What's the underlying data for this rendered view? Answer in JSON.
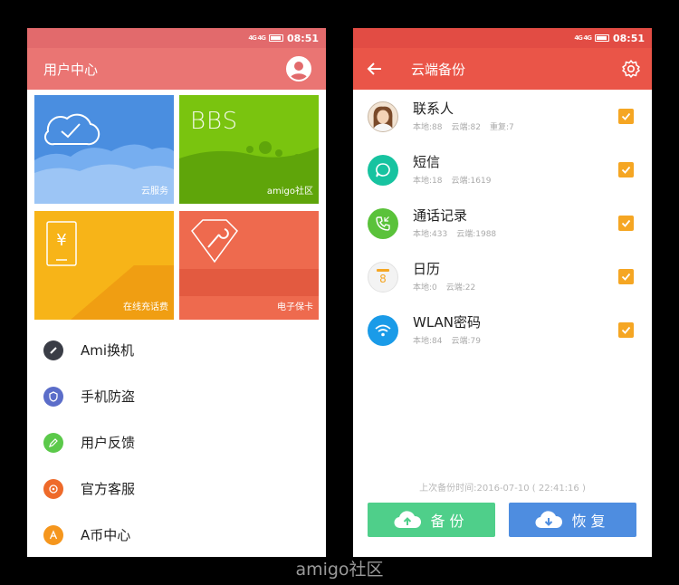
{
  "status_bar": {
    "signal": "4G 4G",
    "time": "08:51"
  },
  "left_screen": {
    "title": "用户中心",
    "tiles": [
      {
        "id": "cloud",
        "label": "云服务",
        "color": "#4a8ee0"
      },
      {
        "id": "bbs",
        "label": "amigo社区",
        "logo_text": "BBS",
        "color": "#7ac40f"
      },
      {
        "id": "recharge",
        "label": "在线充话费",
        "color": "#f7b418"
      },
      {
        "id": "card",
        "label": "电子保卡",
        "color": "#ee6a4e"
      }
    ],
    "menu": [
      {
        "label": "Ami换机",
        "icon": "ami-switch-icon",
        "color": "#3a3d46"
      },
      {
        "label": "手机防盗",
        "icon": "shield-icon",
        "color": "#5b6dc9"
      },
      {
        "label": "用户反馈",
        "icon": "feedback-icon",
        "color": "#5bc94a"
      },
      {
        "label": "官方客服",
        "icon": "customer-service-icon",
        "color": "#ee6a2a"
      },
      {
        "label": "A币中心",
        "icon": "a-coin-icon",
        "color": "#f5961d"
      }
    ]
  },
  "right_screen": {
    "title": "云端备份",
    "items": [
      {
        "name": "联系人",
        "local": "本地:88",
        "cloud": "云端:82",
        "extra": "重复:7",
        "icon": "contacts-avatar-icon",
        "checked": true
      },
      {
        "name": "短信",
        "local": "本地:18",
        "cloud": "云端:1619",
        "extra": "",
        "icon": "sms-icon",
        "checked": true
      },
      {
        "name": "通话记录",
        "local": "本地:433",
        "cloud": "云端:1988",
        "extra": "",
        "icon": "call-log-icon",
        "checked": true
      },
      {
        "name": "日历",
        "local": "本地:0",
        "cloud": "云端:22",
        "extra": "",
        "icon": "calendar-icon",
        "calendar_day": "8",
        "checked": true
      },
      {
        "name": "WLAN密码",
        "local": "本地:84",
        "cloud": "云端:79",
        "extra": "",
        "icon": "wifi-icon",
        "checked": true
      }
    ],
    "last_backup": "上次备份时间:2016-07-10 ( 22:41:16 )",
    "backup_button": "备份",
    "restore_button": "恢复",
    "accent": "#ea5548",
    "checkbox_color": "#f5a623"
  },
  "watermark": "amigo社区"
}
